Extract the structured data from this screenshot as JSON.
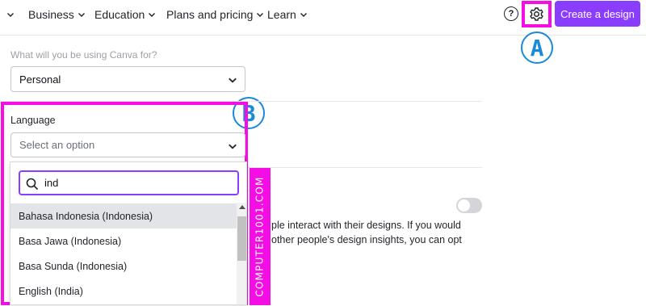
{
  "nav": {
    "items": [
      {
        "label": ""
      },
      {
        "label": "Business"
      },
      {
        "label": "Education"
      },
      {
        "label": "Plans and pricing"
      },
      {
        "label": "Learn"
      }
    ],
    "help_glyph": "?",
    "settings_icon": "gear-icon",
    "create_button": "Create a design"
  },
  "callouts": {
    "a": "A",
    "b": "B"
  },
  "usage": {
    "label": "What will you be using Canva for?",
    "value": "Personal"
  },
  "language": {
    "label": "Language",
    "placeholder": "Select an option",
    "search_value": "ind",
    "options": [
      "Bahasa Indonesia (Indonesia)",
      "Basa Jawa (Indonesia)",
      "Basa Sunda (Indonesia)",
      "English (India)"
    ],
    "highlighted_index": 0
  },
  "insights": {
    "line1": "ple interact with their designs. If you would",
    "line2": "other people's design insights, you can opt",
    "toggle_on": false
  },
  "watermark": "COMPUTER1001.COM",
  "colors": {
    "accent": "#8b3dff",
    "highlight": "#f40ee5",
    "callout": "#1a8ad6"
  }
}
